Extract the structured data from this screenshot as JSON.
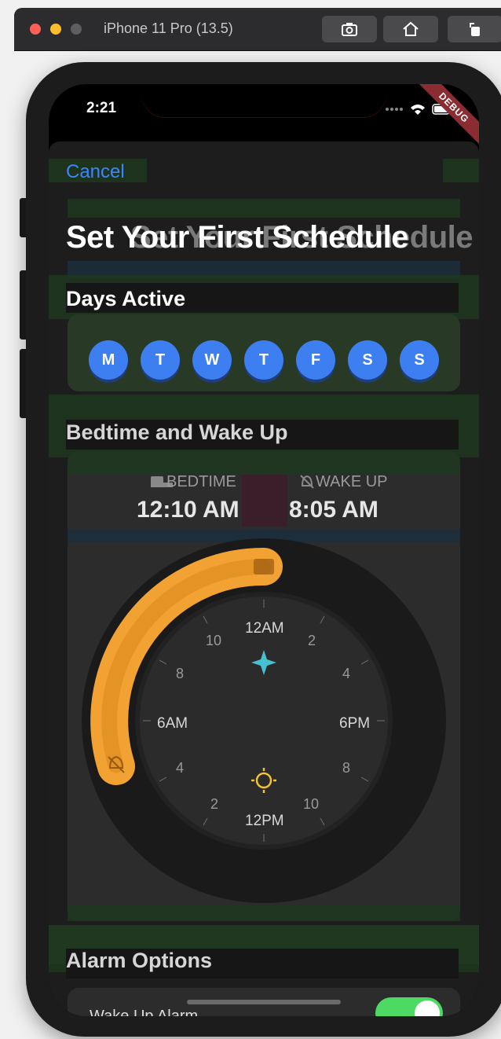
{
  "simulator": {
    "title": "iPhone 11 Pro (13.5)"
  },
  "status_bar": {
    "time": "2:21",
    "debug_banner": "DEBUG"
  },
  "header": {
    "cancel": "Cancel",
    "title": "Set Your First Schedule"
  },
  "days": {
    "heading": "Days Active",
    "items": [
      "M",
      "T",
      "W",
      "T",
      "F",
      "S",
      "S"
    ]
  },
  "sleep": {
    "heading": "Bedtime and Wake Up",
    "bedtime_label": "BEDTIME",
    "bedtime_value": "12:10 AM",
    "wake_label": "WAKE UP",
    "wake_value": "8:05 AM"
  },
  "clock": {
    "labels": {
      "top": "12AM",
      "bottom": "12PM",
      "left": "6AM",
      "right": "6PM"
    },
    "numbers": [
      "2",
      "4",
      "8",
      "10"
    ]
  },
  "alarm": {
    "heading": "Alarm Options",
    "wake_alarm": "Wake Up Alarm"
  },
  "colors": {
    "accent": "#3b86ff",
    "day": "#3d7ef1",
    "arc": "#f2a232",
    "toggle": "#4cd964"
  }
}
